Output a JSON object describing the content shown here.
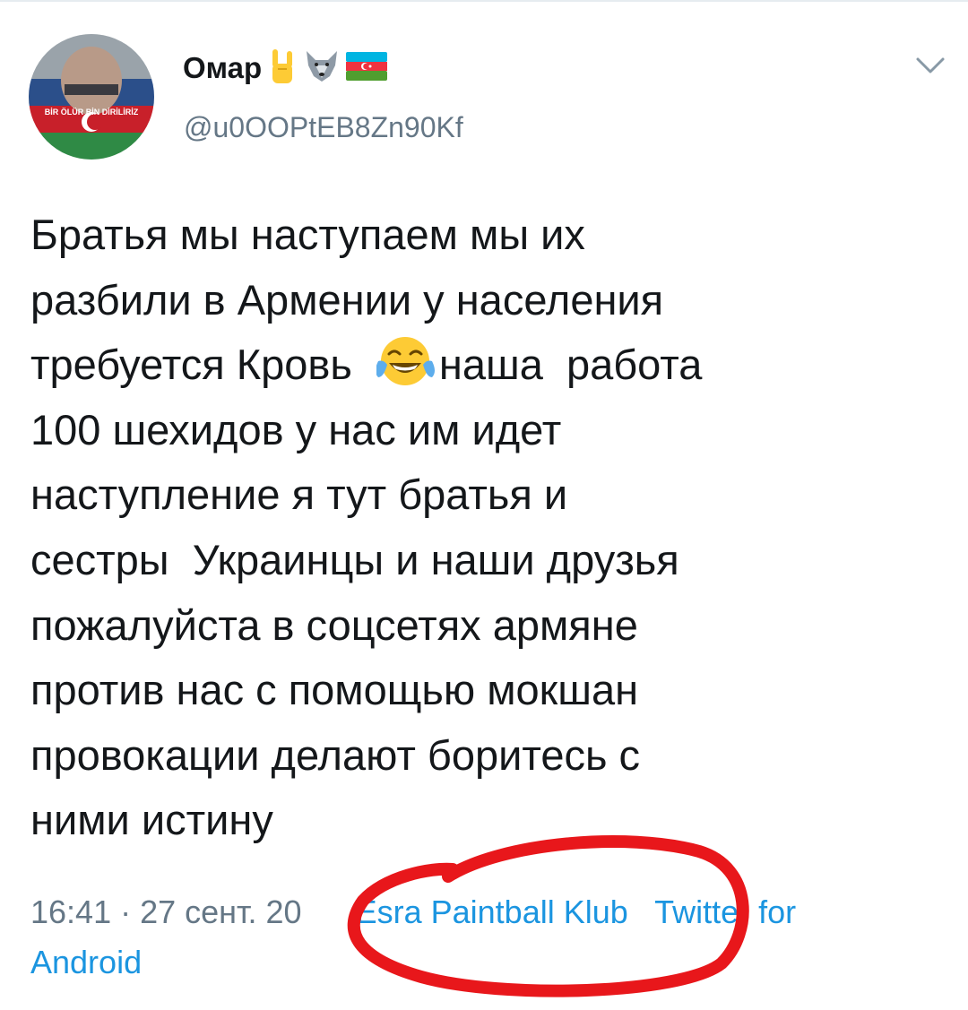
{
  "user": {
    "display_name": "Омар",
    "handle": "@u0OOPtEB8Zn90Kf",
    "avatar_caption": "BİR ÖLÜR BİN DİRİLİRİZ",
    "name_emojis": [
      "sign-of-horns-icon",
      "wolf-face-icon",
      "azerbaijan-flag-icon"
    ]
  },
  "tweet": {
    "lines": [
      "Братья мы наступаем мы их",
      "разбили в Армении у населения",
      "требуется Кровь ",
      "наша  работа",
      "100 шехидов у нас им идет",
      "наступление я тут братья и",
      "сестры  Украинцы и наши друзья",
      "пожалуйста в соцсетях армяне",
      "против нас с помощью мокшан",
      "провокации делают боритесь с",
      "ними истину"
    ],
    "inline_emoji": "face-with-tears-of-joy-icon"
  },
  "meta": {
    "timestamp": "16:41 · 27 сент. 20",
    "hidden_fragment": "",
    "location": "Esra Paintball Klub",
    "client_line1": "Twitter for",
    "client_line2": "Android"
  },
  "colors": {
    "text": "#14171a",
    "secondary": "#657786",
    "link": "#1b95e0",
    "annotation": "#e8171b"
  }
}
